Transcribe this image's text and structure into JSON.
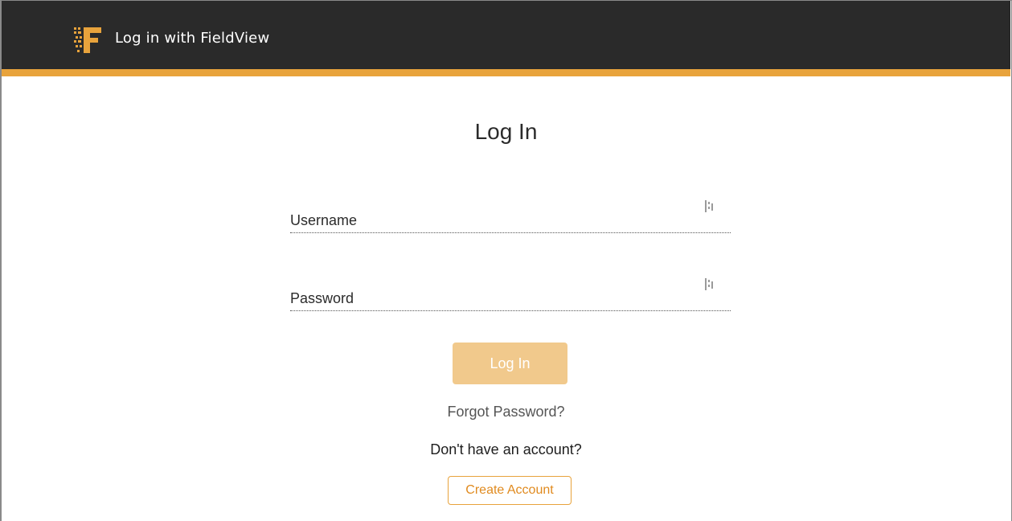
{
  "header": {
    "title": "Log in with FieldView",
    "logo_icon": "fieldview-logo-icon",
    "background_color": "#2a2a2a",
    "accent_color": "#e8a33c"
  },
  "form": {
    "title": "Log In",
    "username": {
      "placeholder": "Username",
      "value": "",
      "icon": "password-manager-icon"
    },
    "password": {
      "placeholder": "Password",
      "value": "",
      "icon": "password-manager-icon"
    },
    "login_label": "Log In",
    "forgot_label": "Forgot Password?",
    "no_account_text": "Don't have an account?",
    "create_account_label": "Create Account",
    "button_color": "#f1c98c"
  }
}
